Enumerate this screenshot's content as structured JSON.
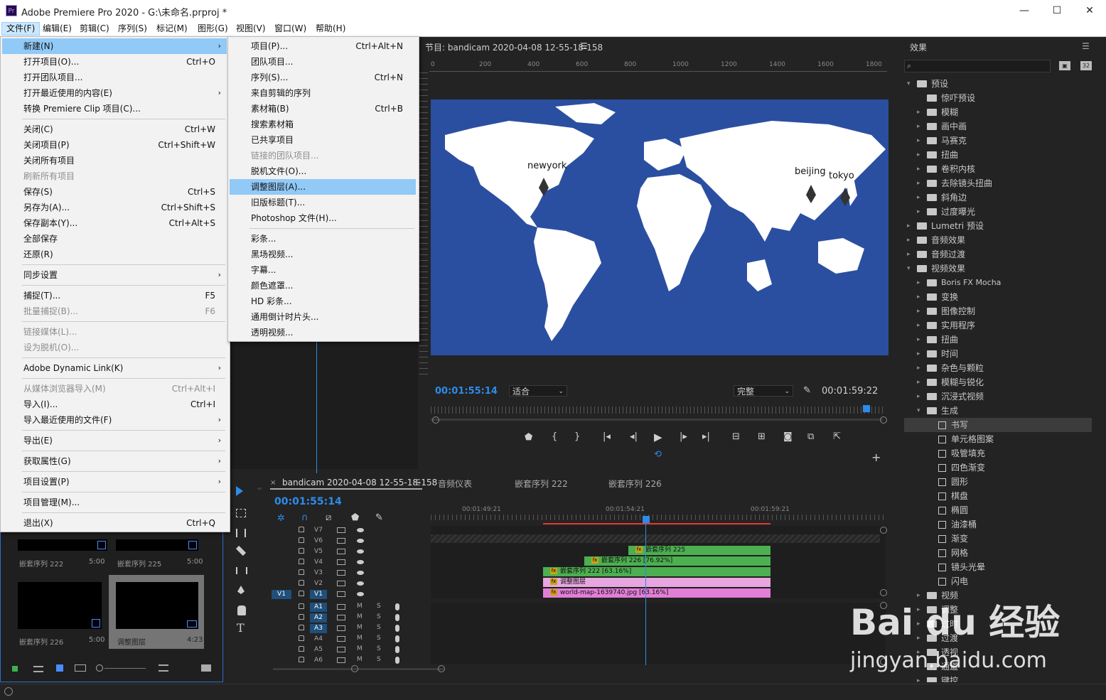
{
  "app": {
    "title": "Adobe Premiere Pro 2020 - G:\\未命名.prproj *",
    "logo": "Pr"
  },
  "window_buttons": {
    "minimize": "—",
    "maximize": "☐",
    "close": "✕"
  },
  "menubar": [
    "文件(F)",
    "编辑(E)",
    "剪辑(C)",
    "序列(S)",
    "标记(M)",
    "图形(G)",
    "视图(V)",
    "窗口(W)",
    "帮助(H)"
  ],
  "file_menu": [
    {
      "label": "新建(N)",
      "shortcut": "",
      "sub": true,
      "highlight": true
    },
    {
      "label": "打开项目(O)...",
      "shortcut": "Ctrl+O"
    },
    {
      "label": "打开团队项目..."
    },
    {
      "label": "打开最近使用的内容(E)",
      "sub": true
    },
    {
      "label": "转换 Premiere Clip 项目(C)..."
    },
    {
      "sep": true
    },
    {
      "label": "关闭(C)",
      "shortcut": "Ctrl+W"
    },
    {
      "label": "关闭项目(P)",
      "shortcut": "Ctrl+Shift+W"
    },
    {
      "label": "关闭所有项目"
    },
    {
      "label": "刷新所有项目",
      "disabled": true
    },
    {
      "label": "保存(S)",
      "shortcut": "Ctrl+S"
    },
    {
      "label": "另存为(A)...",
      "shortcut": "Ctrl+Shift+S"
    },
    {
      "label": "保存副本(Y)...",
      "shortcut": "Ctrl+Alt+S"
    },
    {
      "label": "全部保存"
    },
    {
      "label": "还原(R)"
    },
    {
      "sep": true
    },
    {
      "label": "同步设置",
      "sub": true
    },
    {
      "sep": true
    },
    {
      "label": "捕捉(T)...",
      "shortcut": "F5"
    },
    {
      "label": "批量捕捉(B)...",
      "shortcut": "F6",
      "disabled": true
    },
    {
      "sep": true
    },
    {
      "label": "链接媒体(L)...",
      "disabled": true
    },
    {
      "label": "设为脱机(O)...",
      "disabled": true
    },
    {
      "sep": true
    },
    {
      "label": "Adobe Dynamic Link(K)",
      "sub": true
    },
    {
      "sep": true
    },
    {
      "label": "从媒体浏览器导入(M)",
      "shortcut": "Ctrl+Alt+I",
      "disabled": true
    },
    {
      "label": "导入(I)...",
      "shortcut": "Ctrl+I"
    },
    {
      "label": "导入最近使用的文件(F)",
      "sub": true
    },
    {
      "sep": true
    },
    {
      "label": "导出(E)",
      "sub": true
    },
    {
      "sep": true
    },
    {
      "label": "获取属性(G)",
      "sub": true
    },
    {
      "sep": true
    },
    {
      "label": "项目设置(P)",
      "sub": true
    },
    {
      "sep": true
    },
    {
      "label": "项目管理(M)..."
    },
    {
      "sep": true
    },
    {
      "label": "退出(X)",
      "shortcut": "Ctrl+Q"
    }
  ],
  "new_submenu": [
    {
      "label": "项目(P)...",
      "shortcut": "Ctrl+Alt+N"
    },
    {
      "label": "团队项目..."
    },
    {
      "label": "序列(S)...",
      "shortcut": "Ctrl+N"
    },
    {
      "label": "来自剪辑的序列"
    },
    {
      "label": "素材箱(B)",
      "shortcut": "Ctrl+B"
    },
    {
      "label": "搜索素材箱"
    },
    {
      "label": "已共享项目"
    },
    {
      "label": "链接的团队项目...",
      "disabled": true
    },
    {
      "label": "脱机文件(O)..."
    },
    {
      "label": "调整图层(A)...",
      "highlight": true
    },
    {
      "label": "旧版标题(T)..."
    },
    {
      "label": "Photoshop 文件(H)..."
    },
    {
      "sep": true
    },
    {
      "label": "彩条..."
    },
    {
      "label": "黑场视频..."
    },
    {
      "label": "字幕..."
    },
    {
      "label": "颜色遮罩..."
    },
    {
      "label": "HD 彩条..."
    },
    {
      "label": "通用倒计时片头..."
    },
    {
      "label": "透明视频..."
    }
  ],
  "program_monitor": {
    "title": "节目: bandicam 2020-04-08 12-55-18-158",
    "ruler": [
      "0",
      "200",
      "400",
      "600",
      "800",
      "1000",
      "1200",
      "1400",
      "1600",
      "1800"
    ],
    "timecode": "00:01:55:14",
    "fit": "适合",
    "quality": "完整",
    "duration": "00:01:59:22",
    "labels": {
      "newyork": "newyork",
      "beijing": "beijing",
      "tokyo": "tokyo"
    }
  },
  "timeline": {
    "tabs": [
      "bandicam 2020-04-08 12-55-18-158",
      "音频仪表",
      "嵌套序列 222",
      "嵌套序列 226"
    ],
    "timecode": "00:01:55:14",
    "ticks": [
      "00:01:49:21",
      "00:01:54:21",
      "00:01:59:21"
    ],
    "video_tracks": [
      "V7",
      "V6",
      "V5",
      "V4",
      "V3",
      "V2",
      "V1"
    ],
    "audio_tracks": [
      "A1",
      "A2",
      "A3",
      "A4",
      "A5",
      "A6"
    ],
    "source_patch": "V1",
    "mute": "M",
    "solo": "S",
    "clips": [
      {
        "label": "嵌套序列 225",
        "color": "#4caf50"
      },
      {
        "label": "嵌套序列 226 [76.92%]",
        "color": "#4caf50"
      },
      {
        "label": "嵌套序列 222 [63.16%]",
        "color": "#4caf50"
      },
      {
        "label": "调整图层",
        "color": "#e7a6e0"
      },
      {
        "label": "world-map-1639740.jpg [63.16%]",
        "color": "#e27ed8"
      }
    ]
  },
  "project_bin": {
    "items": [
      {
        "name": "嵌套序列 222",
        "dur": "5:00"
      },
      {
        "name": "嵌套序列 225",
        "dur": "5:00"
      },
      {
        "name": "嵌套序列 226",
        "dur": "5:00"
      },
      {
        "name": "调整图层",
        "dur": "4:23"
      }
    ]
  },
  "effects_panel": {
    "title": "效果",
    "items": [
      {
        "label": "预设",
        "type": "preset",
        "level": 0,
        "open": true
      },
      {
        "label": "惊吓预设",
        "type": "preset",
        "level": 1,
        "noarrow": true
      },
      {
        "label": "模糊",
        "type": "preset",
        "level": 1
      },
      {
        "label": "画中画",
        "type": "preset",
        "level": 1
      },
      {
        "label": "马赛克",
        "type": "preset",
        "level": 1
      },
      {
        "label": "扭曲",
        "type": "preset",
        "level": 1
      },
      {
        "label": "卷积内核",
        "type": "preset",
        "level": 1
      },
      {
        "label": "去除镜头扭曲",
        "type": "preset",
        "level": 1
      },
      {
        "label": "斜角边",
        "type": "preset",
        "level": 1
      },
      {
        "label": "过度曝光",
        "type": "preset",
        "level": 1
      },
      {
        "label": "Lumetri 预设",
        "type": "folder",
        "level": 0
      },
      {
        "label": "音频效果",
        "type": "folder",
        "level": 0
      },
      {
        "label": "音频过渡",
        "type": "folder",
        "level": 0
      },
      {
        "label": "视频效果",
        "type": "folder",
        "level": 0,
        "open": true
      },
      {
        "label": "Boris FX Mocha",
        "type": "folder",
        "level": 1
      },
      {
        "label": "变换",
        "type": "folder",
        "level": 1
      },
      {
        "label": "图像控制",
        "type": "folder",
        "level": 1
      },
      {
        "label": "实用程序",
        "type": "folder",
        "level": 1
      },
      {
        "label": "扭曲",
        "type": "folder",
        "level": 1
      },
      {
        "label": "时间",
        "type": "folder",
        "level": 1
      },
      {
        "label": "杂色与颗粒",
        "type": "folder",
        "level": 1
      },
      {
        "label": "模糊与锐化",
        "type": "folder",
        "level": 1
      },
      {
        "label": "沉浸式视频",
        "type": "folder",
        "level": 1
      },
      {
        "label": "生成",
        "type": "folder",
        "level": 1,
        "open": true
      },
      {
        "label": "书写",
        "type": "effect",
        "level": 2,
        "selected": true
      },
      {
        "label": "单元格图案",
        "type": "effect",
        "level": 2
      },
      {
        "label": "吸管填充",
        "type": "effect",
        "level": 2
      },
      {
        "label": "四色渐变",
        "type": "effect",
        "level": 2
      },
      {
        "label": "圆形",
        "type": "effect",
        "level": 2
      },
      {
        "label": "棋盘",
        "type": "effect",
        "level": 2
      },
      {
        "label": "椭圆",
        "type": "effect",
        "level": 2
      },
      {
        "label": "油漆桶",
        "type": "effect",
        "level": 2
      },
      {
        "label": "渐变",
        "type": "effect",
        "level": 2
      },
      {
        "label": "网格",
        "type": "effect",
        "level": 2
      },
      {
        "label": "镜头光晕",
        "type": "effect",
        "level": 2
      },
      {
        "label": "闪电",
        "type": "effect",
        "level": 2
      },
      {
        "label": "视频",
        "type": "folder",
        "level": 1
      },
      {
        "label": "调整",
        "type": "folder",
        "level": 1
      },
      {
        "label": "过时",
        "type": "folder",
        "level": 1
      },
      {
        "label": "过渡",
        "type": "folder",
        "level": 1
      },
      {
        "label": "透视",
        "type": "folder",
        "level": 1
      },
      {
        "label": "通道",
        "type": "folder",
        "level": 1
      },
      {
        "label": "键控",
        "type": "folder",
        "level": 1
      }
    ]
  },
  "watermark": {
    "brand": "Bai du 经验",
    "url": "jingyan.baidu.com"
  },
  "colors": {
    "accent": "#2d8ceb",
    "map_ocean": "#2b4fa0",
    "green_clip": "#4caf50",
    "pink_clip": "#e27ed8"
  }
}
